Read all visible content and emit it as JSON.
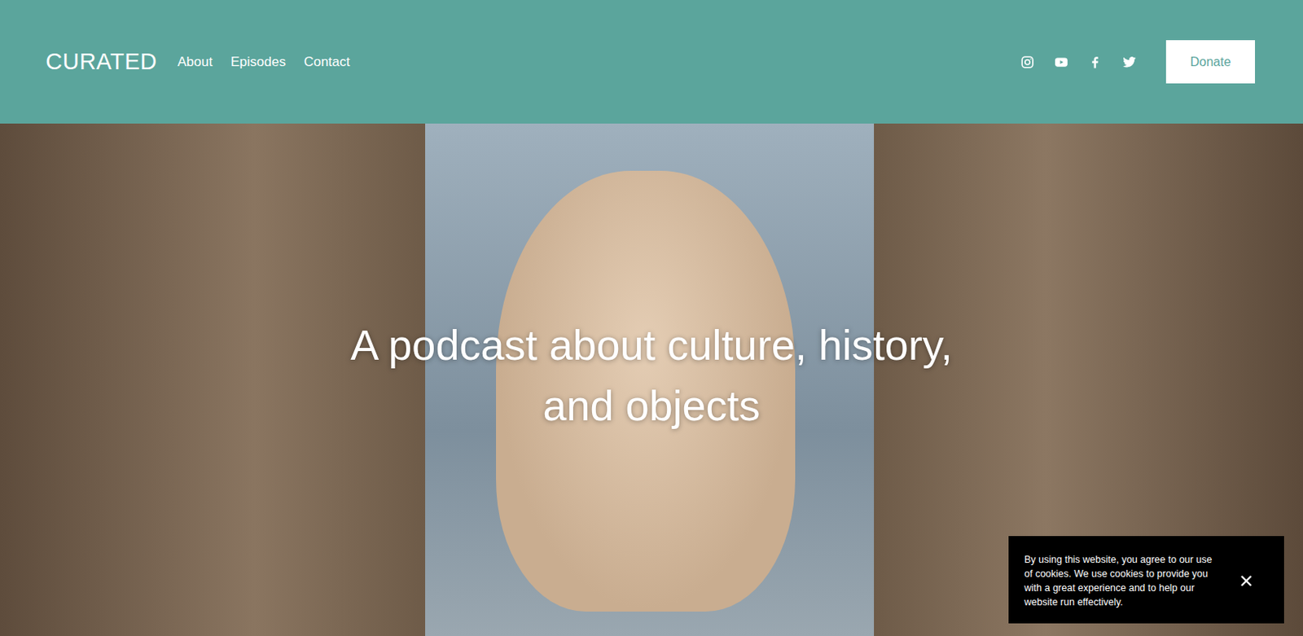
{
  "header": {
    "brand": "CURATED",
    "nav": [
      {
        "label": "About"
      },
      {
        "label": "Episodes"
      },
      {
        "label": "Contact"
      }
    ],
    "social": [
      {
        "kind": "instagram"
      },
      {
        "kind": "youtube"
      },
      {
        "kind": "facebook"
      },
      {
        "kind": "twitter"
      }
    ],
    "donate": "Donate"
  },
  "hero": {
    "title_lines": [
      "A podcast about culture, history,",
      "and objects"
    ]
  },
  "cookie_banner": {
    "text": "By using this website, you agree to our use of cookies. We use cookies to provide you with a great experience and to help our website run effectively."
  }
}
